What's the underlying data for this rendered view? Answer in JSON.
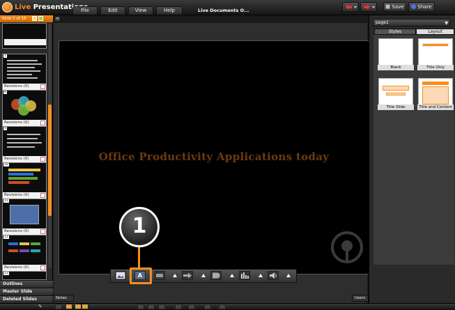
{
  "app": {
    "name_part1": "Live",
    "name_part2": " Presentations"
  },
  "menu": [
    "File",
    "Edit",
    "View",
    "Help"
  ],
  "doc_title": "Live Documents  O...",
  "toolbar": {
    "save_label": "Save",
    "share_label": "Share"
  },
  "left_panel": {
    "slide_counter": "Slide 1 of 16",
    "thumbs": [
      {
        "num": "7",
        "revisions": "Revisions (0)"
      },
      {
        "num": "8",
        "revisions": "Revisions (0)"
      },
      {
        "num": "9",
        "revisions": "Revisions (0)"
      },
      {
        "num": "10",
        "revisions": "Revisions (0)"
      },
      {
        "num": "11",
        "revisions": "Revisions (0)"
      },
      {
        "num": "12",
        "revisions": "Revisions (0)"
      },
      {
        "num": "13"
      }
    ],
    "sections": [
      "Outlines",
      "Master Slide",
      "Deleted Slides"
    ]
  },
  "slide": {
    "title": "Office Productivity Applications today"
  },
  "callout": {
    "number": "1"
  },
  "right_panel": {
    "page_select": "page1",
    "tabs": [
      "Styles",
      "Layout"
    ],
    "layouts": [
      "Blank",
      "Title Only",
      "Title Slide",
      "Title and Content"
    ]
  },
  "bottom": {
    "notes": "Notes",
    "users": "Users"
  },
  "colors": {
    "accent": "#f7901e",
    "title_text": "#6e3a0e"
  }
}
